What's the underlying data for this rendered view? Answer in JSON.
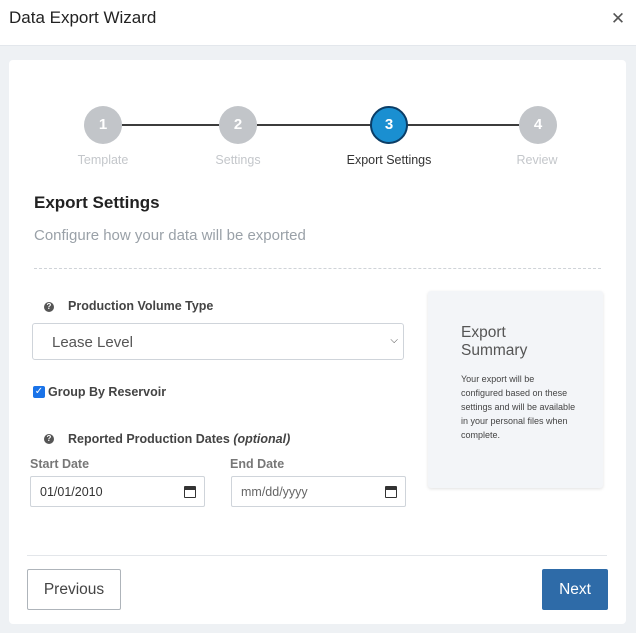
{
  "window": {
    "title": "Data Export Wizard",
    "close_glyph": "✕",
    "close_icon": "close-icon"
  },
  "stepper": {
    "active_color": "#1a8fd1",
    "inactive_color": "#c2c5c9",
    "steps": [
      {
        "number": "1",
        "label": "Template"
      },
      {
        "number": "2",
        "label": "Settings"
      },
      {
        "number": "3",
        "label": "Export Settings",
        "active": true
      },
      {
        "number": "4",
        "label": "Review"
      }
    ]
  },
  "section": {
    "title": "Export Settings",
    "subtitle": "Configure how your data will be exported"
  },
  "form": {
    "volume_type": {
      "label": "Production Volume Type",
      "selected": "Lease Level",
      "help_icon": "help-icon"
    },
    "group_by": {
      "label": "Group By Reservoir",
      "checked": true
    },
    "dates": {
      "label": "Reported Production Dates",
      "optional": "(optional)",
      "start": {
        "label": "Start Date",
        "value": "01/01/2010"
      },
      "end": {
        "label": "End Date",
        "placeholder": "mm/dd/yyyy"
      }
    }
  },
  "summary": {
    "title": "Export Summary",
    "text": "Your export will be configured based on these settings and will be available in your personal files when complete."
  },
  "footer": {
    "previous_label": "Previous",
    "next_label": "Next",
    "next_color": "#2e6ba8"
  }
}
